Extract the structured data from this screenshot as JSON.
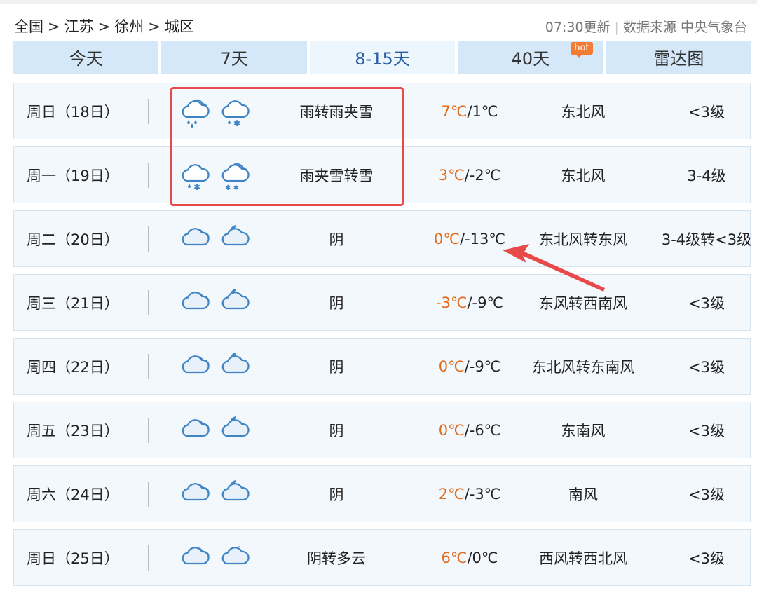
{
  "breadcrumb": [
    "全国",
    "江苏",
    "徐州",
    "城区"
  ],
  "breadcrumb_sep": ">",
  "meta": {
    "updated": "07:30更新",
    "source": "数据来源 中央气象台"
  },
  "tabs": [
    {
      "label": "今天"
    },
    {
      "label": "7天"
    },
    {
      "label": "8-15天",
      "active": true
    },
    {
      "label": "40天",
      "badge": "hot"
    },
    {
      "label": "雷达图"
    }
  ],
  "forecast": [
    {
      "date": "周日（18日）",
      "icon1": "rain-cloud-icon",
      "icon2": "sleet-cloud-icon",
      "desc": "雨转雨夹雪",
      "high": "7℃",
      "low": "/1℃",
      "wind": "东北风",
      "level": "<3级"
    },
    {
      "date": "周一（19日）",
      "icon1": "sleet-cloud-icon",
      "icon2": "snow-cloud-icon",
      "desc": "雨夹雪转雪",
      "high": "3℃",
      "low": "/-2℃",
      "wind": "东北风",
      "level": "3-4级"
    },
    {
      "date": "周二（20日）",
      "icon1": "overcast-icon",
      "icon2": "overcast-night-icon",
      "desc": "阴",
      "high": "0℃",
      "low": "/-13℃",
      "wind": "东北风转东风",
      "level": "3-4级转<3级"
    },
    {
      "date": "周三（21日）",
      "icon1": "overcast-icon",
      "icon2": "overcast-night-icon",
      "desc": "阴",
      "high": "-3℃",
      "low": "/-9℃",
      "wind": "东风转西南风",
      "level": "<3级"
    },
    {
      "date": "周四（22日）",
      "icon1": "overcast-icon",
      "icon2": "overcast-night-icon",
      "desc": "阴",
      "high": "0℃",
      "low": "/-9℃",
      "wind": "东北风转东南风",
      "level": "<3级"
    },
    {
      "date": "周五（23日）",
      "icon1": "overcast-icon",
      "icon2": "overcast-night-icon",
      "desc": "阴",
      "high": "0℃",
      "low": "/-6℃",
      "wind": "东南风",
      "level": "<3级"
    },
    {
      "date": "周六（24日）",
      "icon1": "overcast-icon",
      "icon2": "overcast-night-icon",
      "desc": "阴",
      "high": "2℃",
      "low": "/-3℃",
      "wind": "南风",
      "level": "<3级"
    },
    {
      "date": "周日（25日）",
      "icon1": "overcast-icon",
      "icon2": "partly-cloudy-night-icon",
      "desc": "阴转多云",
      "high": "6℃",
      "low": "/0℃",
      "wind": "西风转西北风",
      "level": "<3级"
    }
  ],
  "colors": {
    "tab_bg": "#d5e8f9",
    "tab_active_text": "#2a5fa8",
    "high_temp": "#e36c1c",
    "icon_stroke": "#3f84c5",
    "annotation": "#e84a4a",
    "hot_badge": "#f47b34"
  }
}
